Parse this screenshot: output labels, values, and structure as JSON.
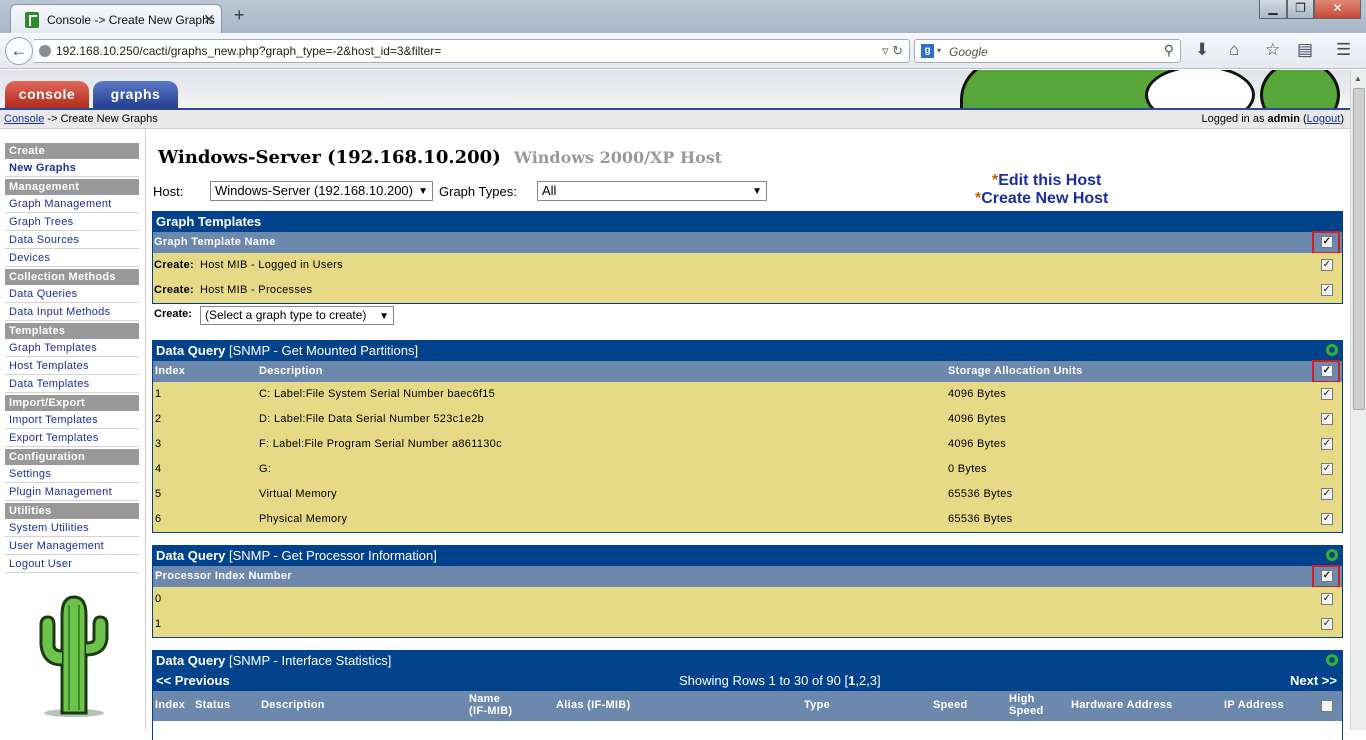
{
  "browser": {
    "tab_title": "Console -> Create New Graphs",
    "tab_close": "✕",
    "new_tab": "+",
    "url": "192.168.10.250/cacti/graphs_new.php?graph_type=-2&host_id=3&filter=",
    "search_placeholder": "Google",
    "search_engine_letter": "g",
    "window_buttons": {
      "minimize": "▁",
      "maximize": "❐",
      "close": "✕"
    }
  },
  "header": {
    "tab_console": "console",
    "tab_graphs": "graphs"
  },
  "breadcrumb": {
    "root": "Console",
    "sep": " -> ",
    "current": "Create New Graphs",
    "logged_prefix": "Logged in as ",
    "user": "admin",
    "logout": "Logout",
    "paren_open": " (",
    "paren_close": ")"
  },
  "menu": [
    {
      "type": "head",
      "label": "Create"
    },
    {
      "type": "item",
      "label": "New Graphs",
      "selected": true
    },
    {
      "type": "head",
      "label": "Management"
    },
    {
      "type": "item",
      "label": "Graph Management"
    },
    {
      "type": "item",
      "label": "Graph Trees"
    },
    {
      "type": "item",
      "label": "Data Sources"
    },
    {
      "type": "item",
      "label": "Devices"
    },
    {
      "type": "head",
      "label": "Collection Methods"
    },
    {
      "type": "item",
      "label": "Data Queries"
    },
    {
      "type": "item",
      "label": "Data Input Methods"
    },
    {
      "type": "head",
      "label": "Templates"
    },
    {
      "type": "item",
      "label": "Graph Templates"
    },
    {
      "type": "item",
      "label": "Host Templates"
    },
    {
      "type": "item",
      "label": "Data Templates"
    },
    {
      "type": "head",
      "label": "Import/Export"
    },
    {
      "type": "item",
      "label": "Import Templates"
    },
    {
      "type": "item",
      "label": "Export Templates"
    },
    {
      "type": "head",
      "label": "Configuration"
    },
    {
      "type": "item",
      "label": "Settings"
    },
    {
      "type": "item",
      "label": "Plugin Management"
    },
    {
      "type": "head",
      "label": "Utilities"
    },
    {
      "type": "item",
      "label": "System Utilities"
    },
    {
      "type": "item",
      "label": "User Management"
    },
    {
      "type": "item",
      "label": "Logout User"
    }
  ],
  "host": {
    "title": "Windows-Server (192.168.10.200)",
    "template": "Windows 2000/XP Host",
    "host_label": "Host:",
    "host_value": "Windows-Server (192.168.10.200)",
    "graph_types_label": "Graph Types:",
    "graph_types_value": "All",
    "edit_link": "Edit this Host",
    "create_link": "Create New Host",
    "star": "*"
  },
  "graph_templates": {
    "title": "Graph Templates",
    "column": "Graph Template Name",
    "rows": [
      {
        "prefix": "Create:",
        "name": "Host MIB - Logged in Users"
      },
      {
        "prefix": "Create:",
        "name": "Host MIB - Processes"
      }
    ],
    "create_label": "Create:",
    "create_select": "(Select a graph type to create)"
  },
  "dq_partitions": {
    "title_bold": "Data Query",
    "title_rest": "[SNMP - Get Mounted Partitions]",
    "columns": [
      "Index",
      "Description",
      "Storage Allocation Units"
    ],
    "rows": [
      [
        "1",
        "C: Label:File System Serial Number baec6f15",
        "4096 Bytes"
      ],
      [
        "2",
        "D: Label:File Data Serial Number 523c1e2b",
        "4096 Bytes"
      ],
      [
        "3",
        "F: Label:File Program Serial Number a861130c",
        "4096 Bytes"
      ],
      [
        "4",
        "G:",
        "0 Bytes"
      ],
      [
        "5",
        "Virtual Memory",
        "65536 Bytes"
      ],
      [
        "6",
        "Physical Memory",
        "65536 Bytes"
      ]
    ]
  },
  "dq_processor": {
    "title_bold": "Data Query",
    "title_rest": "[SNMP - Get Processor Information]",
    "column": "Processor Index Number",
    "rows": [
      "0",
      "1"
    ]
  },
  "dq_interface": {
    "title_bold": "Data Query",
    "title_rest": "[SNMP - Interface Statistics]",
    "prev": "<< Previous",
    "next": "Next >>",
    "showing": "Showing Rows 1 to 30 of 90 [",
    "page_current": "1",
    "pages_rest": ",2,3]",
    "columns": [
      "Index",
      "Status",
      "Description",
      "Name",
      "(IF-MIB)",
      "Alias (IF-MIB)",
      "Type",
      "Speed",
      "High",
      "Speed",
      "Hardware Address",
      "IP Address"
    ]
  },
  "checkmark": "✓",
  "colors": {
    "box_header": "#00438c",
    "column_header": "#6d88ad",
    "row_bg": "#e7da86",
    "highlight": "#cc1f2a",
    "menu_head": "#999999"
  }
}
